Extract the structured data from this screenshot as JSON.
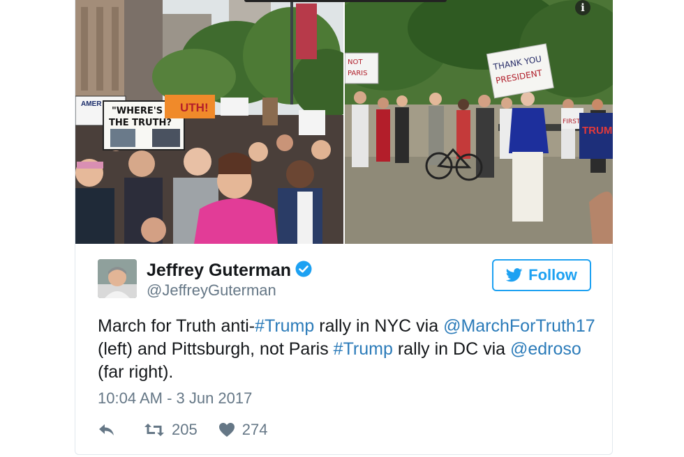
{
  "tweet": {
    "author_name": "Jeffrey Guterman",
    "author_handle": "@JeffreyGuterman",
    "follow_label": "Follow",
    "text_parts": {
      "p1": "March for Truth anti-",
      "p2": "#Trump",
      "p3": " rally in NYC via ",
      "p4": "@MarchForTruth17",
      "p5": " (left) and Pittsburgh, not Paris ",
      "p6": "#Trump",
      "p7": " rally in DC via ",
      "p8": "@edroso",
      "p9": " (far right)."
    },
    "timestamp": "10:04 AM - 3 Jun 2017",
    "retweet_count": "205",
    "like_count": "274"
  },
  "media": {
    "left_signs": {
      "where": "\"WHERE'S",
      "truth": "THE TRUTH?",
      "amer": "AMER",
      "truth_orange": "UTH!"
    },
    "right_signs": {
      "thank": "THANK YOU",
      "president": "PRESIDENT",
      "trump": "TRUMP",
      "first": "FIRST",
      "not": "NOT",
      "paris": "PARIS"
    }
  },
  "colors": {
    "accent": "#1da1f2",
    "link": "#2b7bb9",
    "muted": "#657786",
    "text": "#14171a",
    "border": "#e1e8ed"
  },
  "icons": [
    "info-icon",
    "verified-icon",
    "bird-icon",
    "reply-icon",
    "retweet-icon",
    "heart-icon"
  ]
}
